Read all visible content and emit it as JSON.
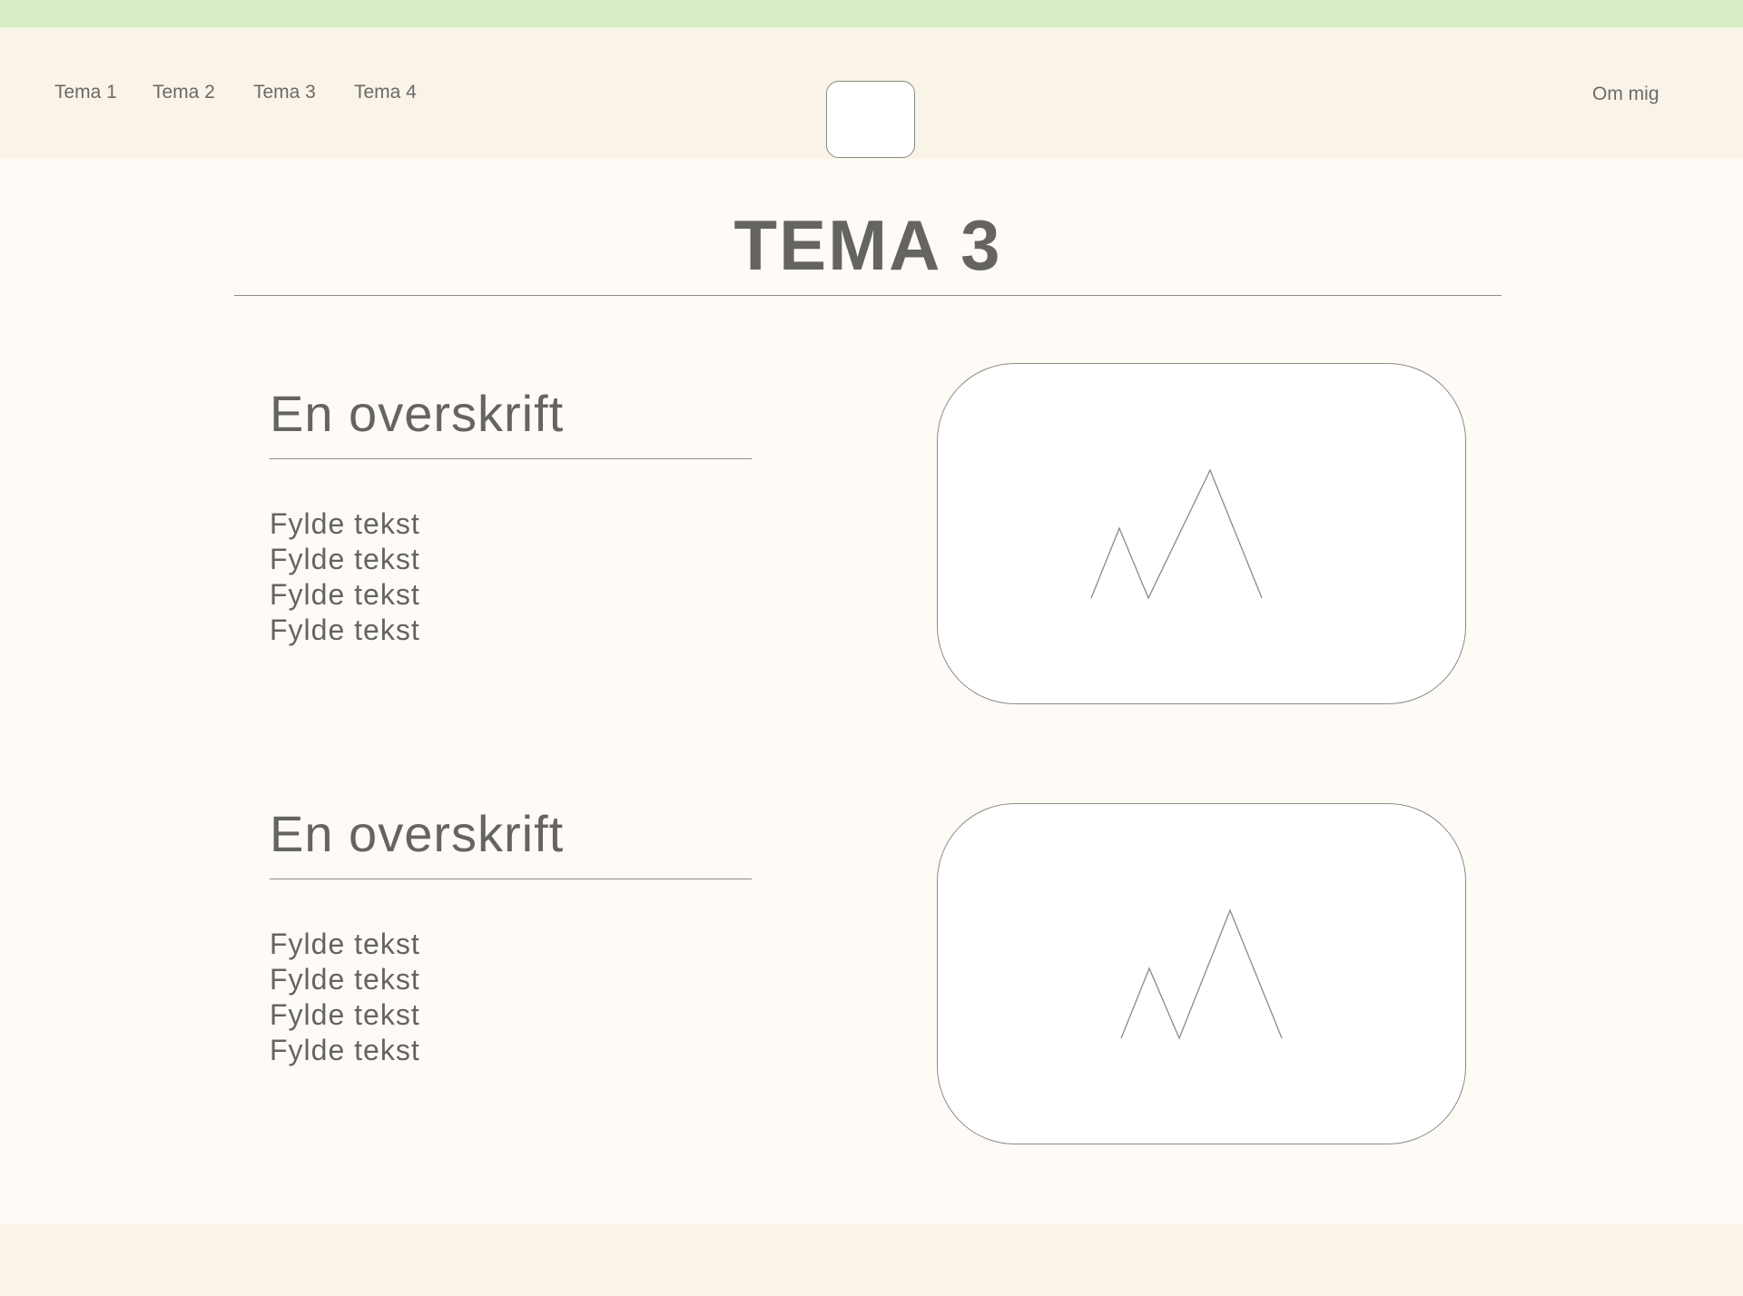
{
  "nav": {
    "items": [
      {
        "label": "Tema 1"
      },
      {
        "label": "Tema 2"
      },
      {
        "label": "Tema 3"
      },
      {
        "label": "Tema 4"
      }
    ],
    "about_label": "Om mig"
  },
  "colors": {
    "top_strip": "#d8ebc4",
    "header_bg": "#faf4e8",
    "page_bg": "#fefbf6",
    "text": "#656461",
    "card_bg": "#ffffff",
    "outline": "#8a8a87"
  },
  "page": {
    "title": "TEMA 3"
  },
  "sections": [
    {
      "heading": "En overskrift",
      "lines": [
        "Fylde tekst",
        "Fylde tekst",
        "Fylde tekst",
        "Fylde tekst"
      ],
      "image_icon": "mountain-icon"
    },
    {
      "heading": "En overskrift",
      "lines": [
        "Fylde tekst",
        "Fylde tekst",
        "Fylde tekst",
        "Fylde tekst"
      ],
      "image_icon": "mountain-icon"
    }
  ]
}
